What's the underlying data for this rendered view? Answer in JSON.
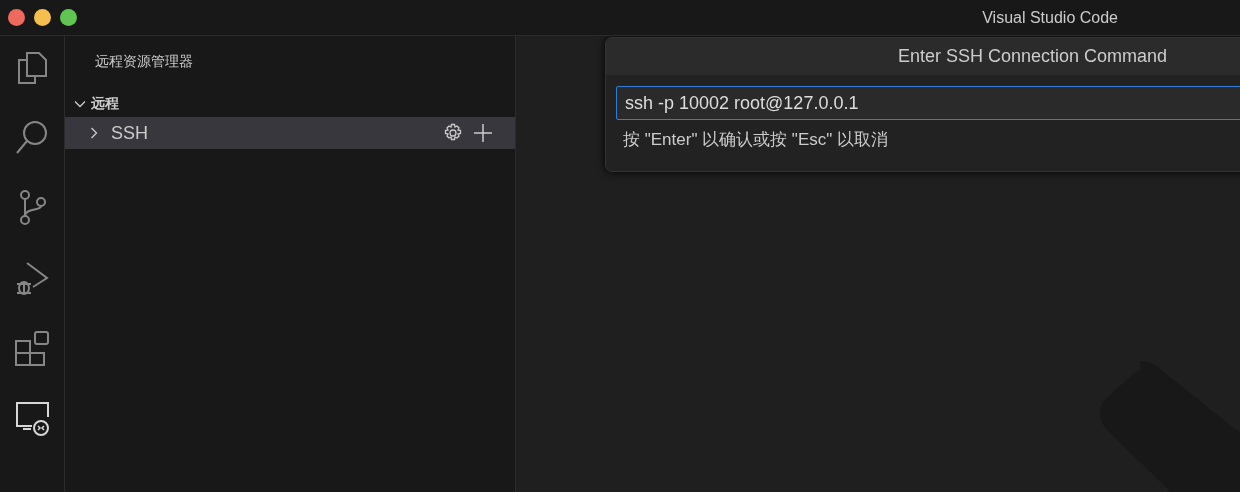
{
  "window": {
    "title": "Visual Studio Code"
  },
  "activity_bar": [
    {
      "kind": "files",
      "selected": false
    },
    {
      "kind": "search",
      "selected": false
    },
    {
      "kind": "source-control",
      "selected": false
    },
    {
      "kind": "run-debug",
      "selected": false
    },
    {
      "kind": "extensions",
      "selected": false
    },
    {
      "kind": "remote",
      "selected": true
    }
  ],
  "sidebar": {
    "title": "远程资源管理器",
    "section": {
      "label": "远程",
      "expanded": true,
      "items": [
        {
          "label": "SSH",
          "expanded": false,
          "selected": true
        }
      ]
    }
  },
  "quick_pick": {
    "title": "Enter SSH Connection Command",
    "value": "ssh -p 10002 root@127.0.0.1",
    "hint": "按 \"Enter\" 以确认或按 \"Esc\" 以取消"
  }
}
